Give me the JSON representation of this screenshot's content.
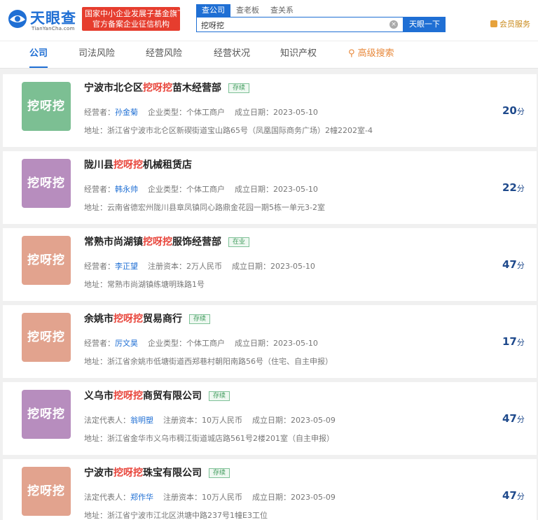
{
  "header": {
    "logo_cn": "天眼查",
    "logo_en": "TianYanCha.com",
    "promo_line1": "国家中小企业发展子基金旗下",
    "promo_line2": "官方备案企业征信机构",
    "tabs": [
      {
        "label": "查公司"
      },
      {
        "label": "查老板"
      },
      {
        "label": "查关系"
      }
    ],
    "search_value": "挖呀挖",
    "search_button": "天眼一下",
    "vip_label": "会员服务"
  },
  "nav": {
    "items": [
      {
        "label": "公司"
      },
      {
        "label": "司法风险"
      },
      {
        "label": "经营风险"
      },
      {
        "label": "经营状况"
      },
      {
        "label": "知识产权"
      },
      {
        "label": "高级搜索"
      }
    ]
  },
  "results": [
    {
      "avatar": "挖呀挖",
      "avatar_color": "#7cbf93",
      "name_pre": "宁波市北仑区",
      "name_hl": "挖呀挖",
      "name_post": "苗木经营部",
      "status": "存续",
      "person_label": "经营者：",
      "person": "孙金菊",
      "field2": "企业类型：个体工商户",
      "date": "成立日期：2023-05-10",
      "address": "地址：浙江省宁波市北仑区新碶街道宝山路65号（凤凰国际商务广场）2幢2202室-4",
      "score": "20",
      "score_unit": "分"
    },
    {
      "avatar": "挖呀挖",
      "avatar_color": "#b78dbe",
      "name_pre": "陇川县",
      "name_hl": "挖呀挖",
      "name_post": "机械租赁店",
      "status": "",
      "person_label": "经营者：",
      "person": "韩永帅",
      "field2": "企业类型：个体工商户",
      "date": "成立日期：2023-05-10",
      "address": "地址：云南省德宏州陇川县章凤镇同心路鼎金花园一期5栋一单元3-2室",
      "score": "22",
      "score_unit": "分"
    },
    {
      "avatar": "挖呀挖",
      "avatar_color": "#e2a38e",
      "name_pre": "常熟市尚湖镇",
      "name_hl": "挖呀挖",
      "name_post": "服饰经营部",
      "status": "在业",
      "person_label": "经营者：",
      "person": "李正望",
      "field2": "注册资本：2万人民币",
      "date": "成立日期：2023-05-10",
      "address": "地址：常熟市尚湖镇练塘明珠路1号",
      "score": "47",
      "score_unit": "分"
    },
    {
      "avatar": "挖呀挖",
      "avatar_color": "#e2a38e",
      "name_pre": "余姚市",
      "name_hl": "挖呀挖",
      "name_post": "贸易商行",
      "status": "存续",
      "person_label": "经营者：",
      "person": "厉文昊",
      "field2": "企业类型：个体工商户",
      "date": "成立日期：2023-05-10",
      "address": "地址：浙江省余姚市低塘街道西郑巷村朝阳南路56号（住宅、自主申报）",
      "score": "17",
      "score_unit": "分"
    },
    {
      "avatar": "挖呀挖",
      "avatar_color": "#b78dbe",
      "name_pre": "义乌市",
      "name_hl": "挖呀挖",
      "name_post": "商贸有限公司",
      "status": "存续",
      "person_label": "法定代表人：",
      "person": "翁明塑",
      "field2": "注册资本：10万人民币",
      "date": "成立日期：2023-05-09",
      "address": "地址：浙江省金华市义乌市稠江街道城店路561号2楼201室（自主申报）",
      "score": "47",
      "score_unit": "分"
    },
    {
      "avatar": "挖呀挖",
      "avatar_color": "#e2a38e",
      "name_pre": "宁波市",
      "name_hl": "挖呀挖",
      "name_post": "珠宝有限公司",
      "status": "存续",
      "person_label": "法定代表人：",
      "person": "郑作华",
      "field2": "注册资本：10万人民币",
      "date": "成立日期：2023-05-09",
      "address": "地址：浙江省宁波市江北区洪塘中路237号1幢E3工位",
      "score": "47",
      "score_unit": "分"
    }
  ]
}
